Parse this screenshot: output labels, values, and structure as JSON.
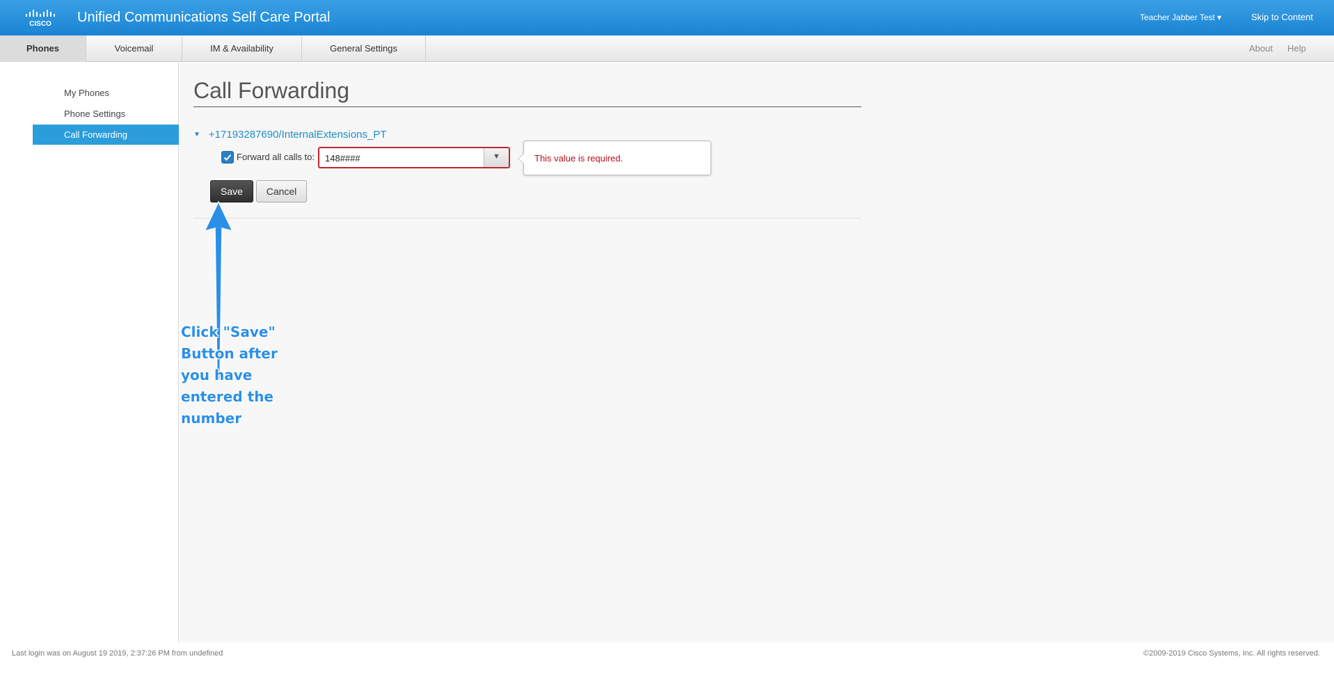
{
  "header": {
    "logo_text": "CISCO",
    "title": "Unified Communications Self Care Portal",
    "user": "Teacher Jabber Test ▾",
    "skip": "Skip to Content"
  },
  "nav": {
    "tabs": [
      {
        "label": "Phones",
        "active": true
      },
      {
        "label": "Voicemail"
      },
      {
        "label": "IM & Availability"
      },
      {
        "label": "General Settings"
      }
    ],
    "about": "About",
    "help": "Help"
  },
  "sidebar": {
    "items": [
      {
        "label": "My Phones"
      },
      {
        "label": "Phone Settings"
      },
      {
        "label": "Call Forwarding",
        "active": true
      }
    ]
  },
  "main": {
    "title": "Call Forwarding",
    "line": "+17193287690/InternalExtensions_PT",
    "forward_label": "Forward all calls to:",
    "forward_checked": true,
    "forward_value": "148####",
    "error_message": "This value is required.",
    "save_label": "Save",
    "cancel_label": "Cancel"
  },
  "annotation": {
    "text": "Click \"Save\" Button after you have entered the number"
  },
  "footer": {
    "last_login": "Last login was on August 19 2019, 2:37:26 PM from undefined",
    "copyright": "©2009-2019 Cisco Systems, Inc. All rights reserved."
  },
  "colors": {
    "header": "#1a84d2",
    "accent": "#2b9ddb",
    "error": "#b5121b",
    "annotation": "#2b8fe8"
  }
}
